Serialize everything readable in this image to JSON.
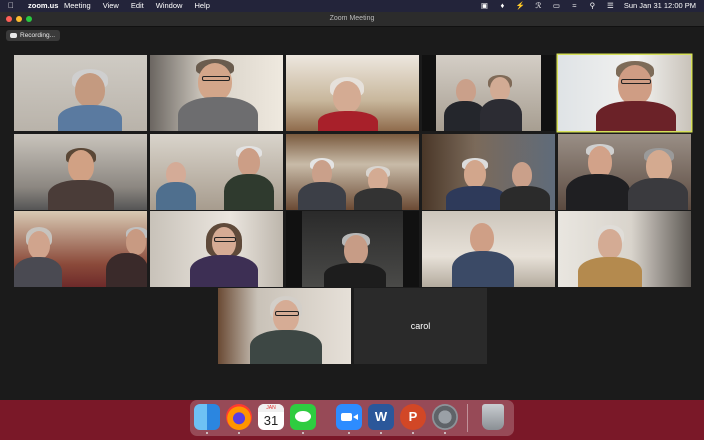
{
  "menubar": {
    "apple_icon": "apple-icon",
    "app_name": "zoom.us",
    "menus": [
      "Meeting",
      "View",
      "Edit",
      "Window",
      "Help"
    ],
    "datetime": "Sun Jan 31   12:00 PM"
  },
  "window": {
    "title": "Zoom Meeting",
    "traffic_lights": [
      "#ff5f57",
      "#febc2e",
      "#28c840"
    ]
  },
  "recording": {
    "label": "Recording...",
    "icon": "cloud-record-icon"
  },
  "participants": {
    "carol_name": "carol",
    "speaker_highlight_color": "#d7e15a"
  },
  "dock": {
    "items": [
      "Finder",
      "Firefox",
      "Calendar",
      "Messages",
      "Zoom",
      "Word",
      "PowerPoint",
      "System Preferences",
      "Trash"
    ],
    "calendar_month": "JAN",
    "calendar_day": "31",
    "word_letter": "W",
    "powerpoint_letter": "P"
  }
}
